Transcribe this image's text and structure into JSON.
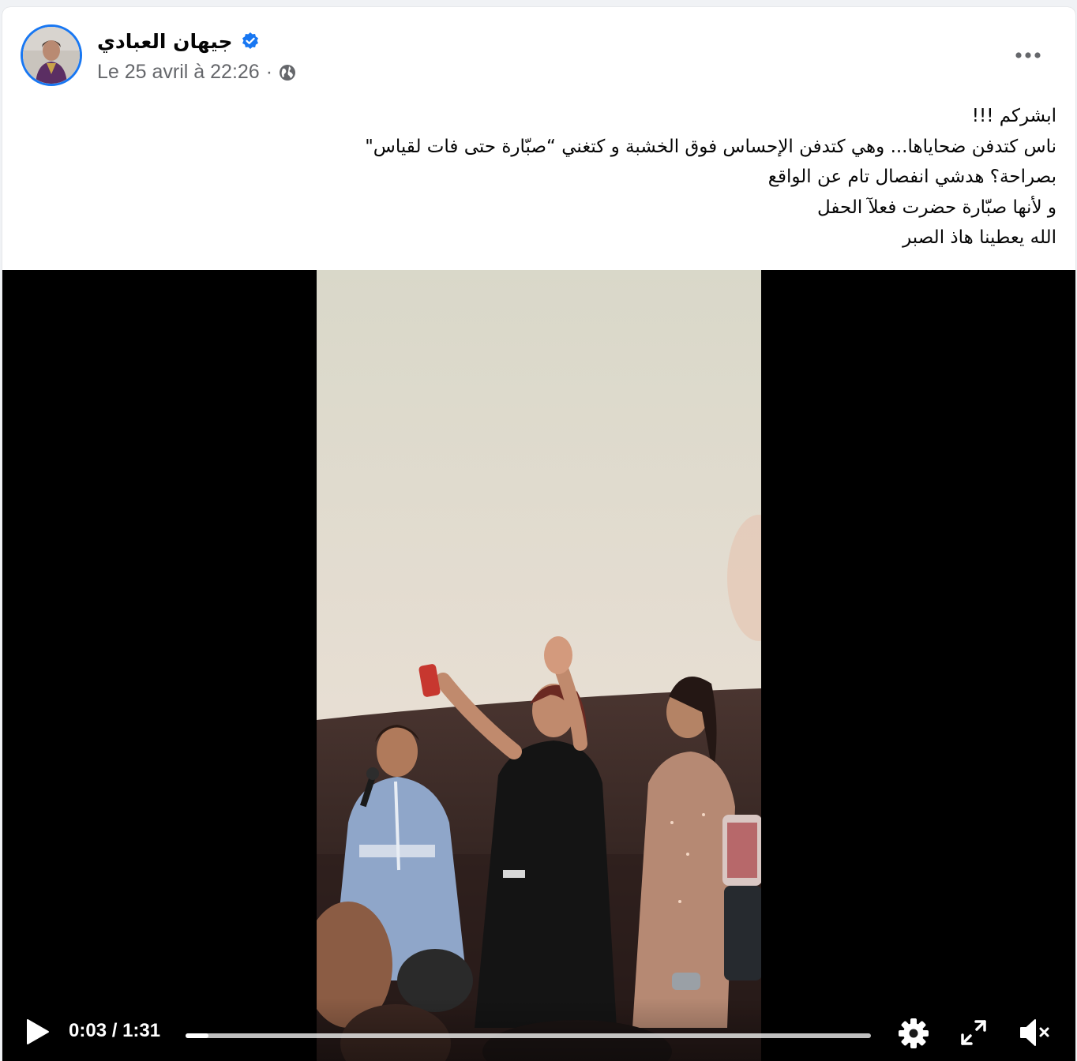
{
  "post": {
    "author_name": "جيهان العبادي",
    "verified": true,
    "timestamp": "Le 25 avril à 22:26",
    "separator": "·",
    "privacy_icon": "globe-icon",
    "menu_icon": "more-horizontal-icon",
    "text_lines": [
      "ابشركم !!!",
      "ناس كتدفن ضحاياها... وهي كتدفن الإحساس فوق الخشبة و كتغني “صبّارة حتى فات لقياس\"",
      "بصراحة؟  هدشي انفصال تام عن الواقع",
      "و لأنها صبّارة حضرت فعلآ الحفل",
      "الله يعطينا هاذ الصبر"
    ]
  },
  "video": {
    "current_time": "0:03",
    "time_separator": " / ",
    "duration": "1:31",
    "progress_fraction": 0.033,
    "controls": [
      "play-icon",
      "settings-gear-icon",
      "fullscreen-icon",
      "muted-speaker-icon"
    ]
  },
  "colors": {
    "accent": "#1877f2",
    "text_primary": "#050505",
    "text_secondary": "#65676b",
    "video_background": "#000000"
  }
}
